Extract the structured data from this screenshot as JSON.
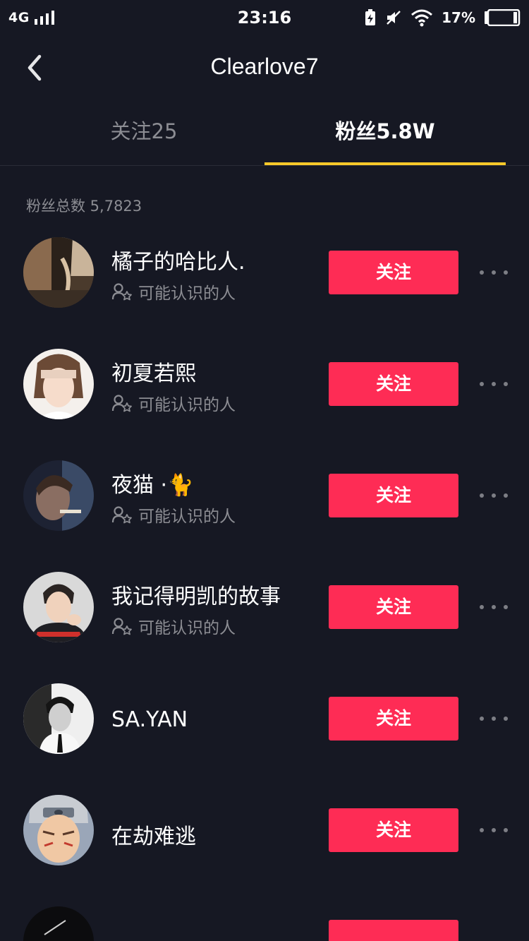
{
  "status_bar": {
    "network": "4G",
    "time": "23:16",
    "battery_percent": "17%"
  },
  "header": {
    "title": "Clearlove7",
    "back_icon": "chevron-left-icon"
  },
  "tabs": {
    "following": "关注25",
    "followers": "粉丝5.8W",
    "active": "followers",
    "underline_color": "#f8c92a"
  },
  "followers": {
    "total_label": "粉丝总数 5,7823",
    "items": [
      {
        "name": "橘子的哈比人.",
        "subtitle": "可能认识的人",
        "button": "关注"
      },
      {
        "name": "初夏若熙",
        "subtitle": "可能认识的人",
        "button": "关注"
      },
      {
        "name": "夜猫 ·",
        "emoji": "🐈",
        "subtitle": "可能认识的人",
        "button": "关注"
      },
      {
        "name": "我记得明凯的故事",
        "subtitle": "可能认识的人",
        "button": "关注"
      },
      {
        "name": "SA.YAN",
        "button": "关注"
      },
      {
        "name": "在劫难逃",
        "button": "关注"
      }
    ]
  },
  "colors": {
    "background": "#161823",
    "follow_button": "#fe2c55",
    "secondary_text": "#8c8d93"
  }
}
